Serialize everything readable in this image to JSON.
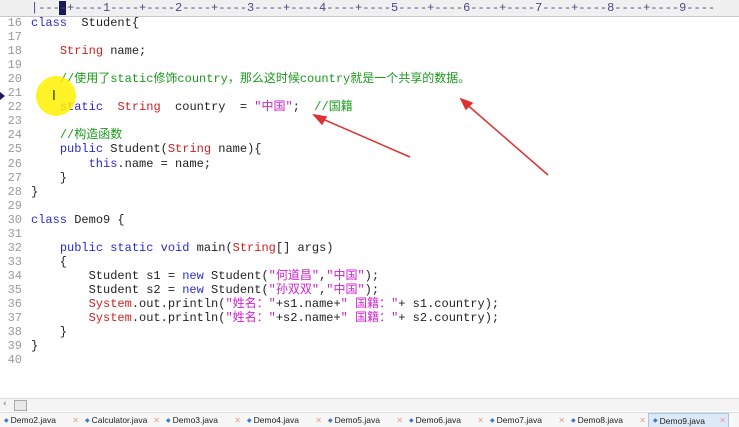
{
  "ruler": "|----+----1----+----2----+----3----+----4----+----5----+----6----+----7----+----8----+----9----",
  "lines": [
    {
      "n": "16",
      "t": [
        [
          "kw",
          "class"
        ],
        [
          "",
          "  Student{"
        ]
      ]
    },
    {
      "n": "17",
      "t": []
    },
    {
      "n": "18",
      "t": [
        [
          "",
          "    "
        ],
        [
          "ty",
          "String"
        ],
        [
          "",
          " name;"
        ]
      ]
    },
    {
      "n": "19",
      "t": []
    },
    {
      "n": "20",
      "t": [
        [
          "",
          "    "
        ],
        [
          "cm",
          "//使用了static修饰country，那么这时候country就是一个共享的数据。"
        ]
      ]
    },
    {
      "n": "21",
      "t": []
    },
    {
      "n": "22",
      "t": [
        [
          "",
          "    "
        ],
        [
          "kw",
          "static"
        ],
        [
          "",
          "  "
        ],
        [
          "ty",
          "String"
        ],
        [
          "",
          "  country  = "
        ],
        [
          "str",
          "\"中国\""
        ],
        [
          "",
          ";  "
        ],
        [
          "cm",
          "//国籍"
        ]
      ]
    },
    {
      "n": "23",
      "t": []
    },
    {
      "n": "24",
      "t": [
        [
          "",
          "    "
        ],
        [
          "cm",
          "//构造函数"
        ]
      ]
    },
    {
      "n": "25",
      "t": [
        [
          "",
          "    "
        ],
        [
          "kw",
          "public"
        ],
        [
          "",
          " Student("
        ],
        [
          "ty",
          "String"
        ],
        [
          "",
          " name){"
        ]
      ]
    },
    {
      "n": "26",
      "t": [
        [
          "",
          "        "
        ],
        [
          "kw",
          "this"
        ],
        [
          "",
          ".name = name;"
        ]
      ]
    },
    {
      "n": "27",
      "t": [
        [
          "",
          "    }"
        ]
      ]
    },
    {
      "n": "28",
      "t": [
        [
          "",
          "}"
        ]
      ]
    },
    {
      "n": "29",
      "t": []
    },
    {
      "n": "30",
      "t": [
        [
          "kw",
          "class"
        ],
        [
          "",
          " Demo9 {"
        ]
      ]
    },
    {
      "n": "31",
      "t": []
    },
    {
      "n": "32",
      "t": [
        [
          "",
          "    "
        ],
        [
          "kw",
          "public static void"
        ],
        [
          "",
          " main("
        ],
        [
          "ty",
          "String"
        ],
        [
          "",
          "[] args)"
        ]
      ]
    },
    {
      "n": "33",
      "t": [
        [
          "",
          "    {"
        ]
      ]
    },
    {
      "n": "34",
      "t": [
        [
          "",
          "        Student s1 = "
        ],
        [
          "kw",
          "new"
        ],
        [
          "",
          " Student("
        ],
        [
          "str",
          "\"何道昌\""
        ],
        [
          "",
          ","
        ],
        [
          "str",
          "\"中国\""
        ],
        [
          "",
          ");"
        ]
      ]
    },
    {
      "n": "35",
      "t": [
        [
          "",
          "        Student s2 = "
        ],
        [
          "kw",
          "new"
        ],
        [
          "",
          " Student("
        ],
        [
          "str",
          "\"孙双双\""
        ],
        [
          "",
          ","
        ],
        [
          "str",
          "\"中国\""
        ],
        [
          "",
          ");"
        ]
      ]
    },
    {
      "n": "36",
      "t": [
        [
          "",
          "        "
        ],
        [
          "sys",
          "System"
        ],
        [
          "",
          ".out.println("
        ],
        [
          "str",
          "\"姓名：\""
        ],
        [
          "",
          "+s1.name+"
        ],
        [
          "str",
          "\" 国籍：\""
        ],
        [
          "",
          "+ s1.country);"
        ]
      ]
    },
    {
      "n": "37",
      "t": [
        [
          "",
          "        "
        ],
        [
          "sys",
          "System"
        ],
        [
          "",
          ".out.println("
        ],
        [
          "str",
          "\"姓名：\""
        ],
        [
          "",
          "+s2.name+"
        ],
        [
          "str",
          "\" 国籍：\""
        ],
        [
          "",
          "+ s2.country);"
        ]
      ]
    },
    {
      "n": "38",
      "t": [
        [
          "",
          "    }"
        ]
      ]
    },
    {
      "n": "39",
      "t": [
        [
          "",
          "}"
        ]
      ]
    },
    {
      "n": "40",
      "t": []
    }
  ],
  "tabs": [
    {
      "label": "Demo2.java",
      "active": false
    },
    {
      "label": "Calculator.java",
      "active": false
    },
    {
      "label": "Demo3.java",
      "active": false
    },
    {
      "label": "Demo4.java",
      "active": false
    },
    {
      "label": "Demo5.java",
      "active": false
    },
    {
      "label": "Demo6.java",
      "active": false
    },
    {
      "label": "Demo7.java",
      "active": false
    },
    {
      "label": "Demo8.java",
      "active": false
    },
    {
      "label": "Demo9.java",
      "active": true
    }
  ],
  "colors": {
    "annotation_arrow": "#e03030",
    "highlight": "#fff000"
  }
}
